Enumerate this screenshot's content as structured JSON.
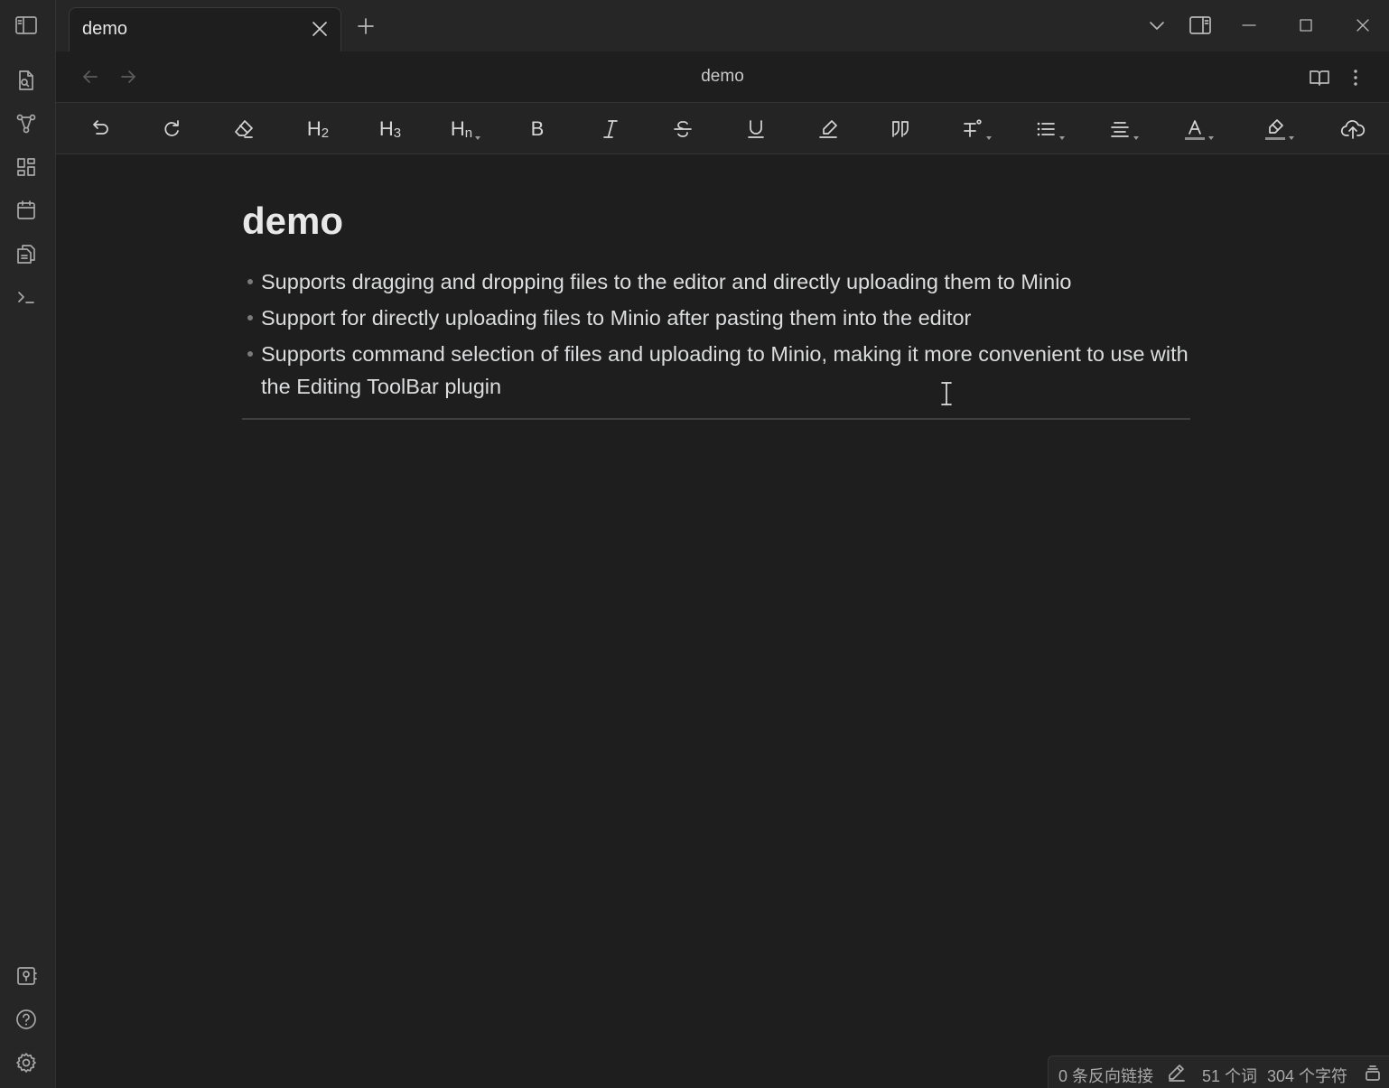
{
  "tab": {
    "title": "demo"
  },
  "header": {
    "title": "demo"
  },
  "document": {
    "title": "demo",
    "bullets": [
      "Supports dragging and dropping files to the editor and directly uploading them to Minio",
      "Support for directly uploading files to Minio after pasting them into the editor",
      "Supports command selection of files and uploading to Minio, making it more convenient to use with the Editing ToolBar plugin"
    ]
  },
  "toolbar": {
    "h2": "H",
    "h2_sub": "2",
    "h3": "H",
    "h3_sub": "3",
    "hn": "H",
    "hn_sub": "n",
    "bold": "B"
  },
  "status": {
    "backlinks": "0 条反向链接",
    "words": "51 个词",
    "characters": "304 个字符"
  },
  "icons": {
    "ribbon_top": [
      "open-quick-switcher-icon",
      "graph-view-icon",
      "canvas-icon",
      "daily-note-calendar-icon",
      "templates-icon",
      "command-palette-icon"
    ],
    "ribbon_bottom": [
      "vault-switch-icon",
      "help-icon",
      "settings-icon"
    ]
  },
  "colors": {
    "background": "#1e1e1e",
    "ribbon": "#262626",
    "text": "#dcddde"
  }
}
